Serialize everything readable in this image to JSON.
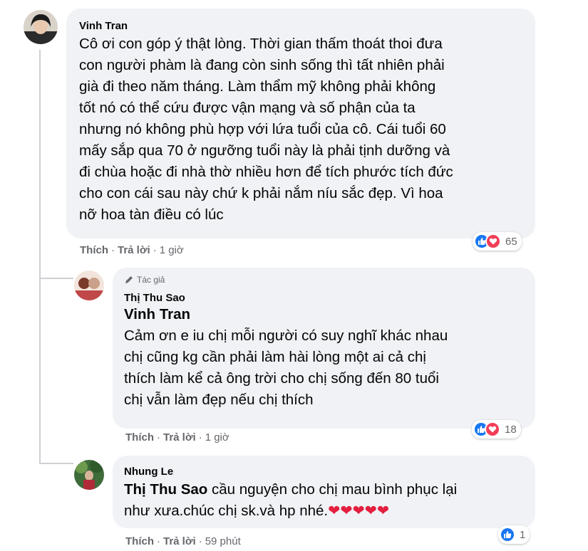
{
  "comments": [
    {
      "author": "Vinh Tran",
      "lines": [
        "Cô ơi con góp ý thật lòng. Thời gian thấm thoát thoi đưa",
        "con người phàm là đang còn sinh sống thì tất nhiên phải",
        "già đi theo năm tháng. Làm thẩm mỹ không phải không",
        "tốt nó có thể cứu được vận mạng và số phận của ta",
        "nhưng nó không phù hợp với lứa tuổi của cô. Cái tuổi 60",
        "mấy sắp qua 70 ở ngưỡng tuổi này là phải tịnh dưỡng và",
        "đi chùa hoặc đi nhà thờ nhiều hơn để tích phước tích đức",
        "cho con cái sau này chứ k phải nắm níu sắc đẹp. Vì hoa",
        "nỡ hoa tàn điều có lúc"
      ],
      "like_label": "Thích",
      "reply_label": "Trả lời",
      "time": "1 giờ",
      "reaction_count": "65"
    },
    {
      "badge": "Tác giả",
      "author": "Thị Thu Sao",
      "mention": "Vinh Tran",
      "lines": [
        "Cảm ơn e iu chị mỗi người có suy nghĩ khác nhau",
        "chị cũng kg cần phải làm hài lòng một ai cả chị",
        "thích làm kể cả ông trời cho chị sống đến 80 tuổi",
        "chị vẫn làm đẹp nếu chị thích"
      ],
      "like_label": "Thích",
      "reply_label": "Trả lời",
      "time": "1 giờ",
      "reaction_count": "18"
    },
    {
      "author": "Nhung Le",
      "mention": "Thị Thu Sao",
      "line1_rest": " cầu nguyện cho chị mau bình phục lại",
      "line2": "như xưa.chúc chị sk.và hp nhé.",
      "hearts": "❤❤❤❤❤",
      "like_label": "Thích",
      "reply_label": "Trả lời",
      "time": "59 phút",
      "reaction_count": "1"
    }
  ],
  "separator": "·",
  "colors": {
    "bubble": "#f0f2f5",
    "like_blue": "#1877f2",
    "love_red": "#f33e58",
    "meta_gray": "#65676b"
  }
}
